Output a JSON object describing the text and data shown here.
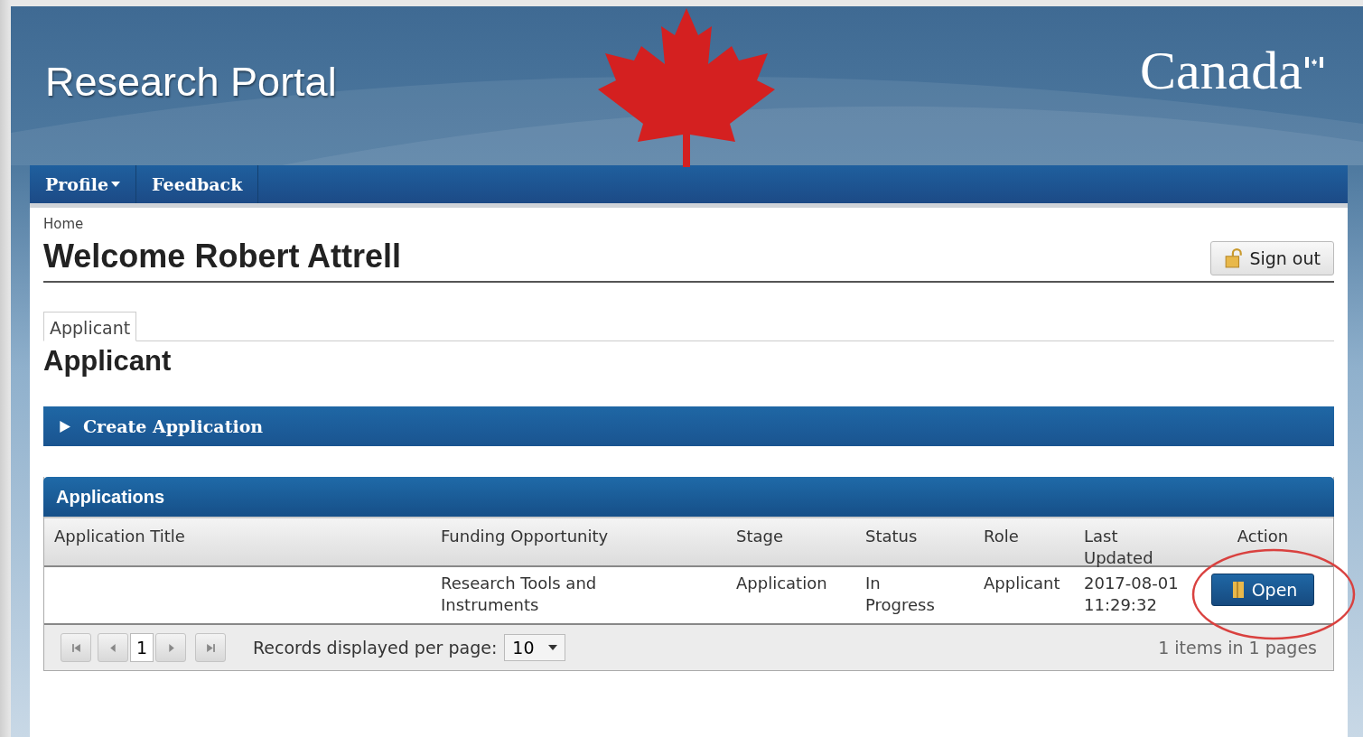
{
  "header": {
    "title": "Research Portal",
    "wordmark": "Canada"
  },
  "nav": [
    {
      "label": "Profile",
      "dropdown": true
    },
    {
      "label": "Feedback",
      "dropdown": false
    }
  ],
  "breadcrumb": "Home",
  "welcome": "Welcome Robert Attrell",
  "sign_out": "Sign out",
  "tabs": [
    {
      "label": "Applicant",
      "selected": true
    }
  ],
  "section_title": "Applicant",
  "create_application": {
    "label": "Create Application",
    "expanded": false
  },
  "applications": {
    "title": "Applications",
    "columns": [
      "Application Title",
      "Funding Opportunity",
      "Stage",
      "Status",
      "Role",
      "Last Updated",
      "Action"
    ],
    "rows": [
      {
        "funding_opportunity": "Research Tools and Instruments",
        "stage": "Application",
        "status": "In Progress",
        "role": "Applicant",
        "last_updated": "2017-08-01 11:29:32",
        "action": "Open",
        "highlighted": true
      }
    ],
    "pager": {
      "page": "1",
      "per_page_label": "Records displayed per page:",
      "per_page": "10",
      "summary": "1 items in 1 pages"
    }
  }
}
